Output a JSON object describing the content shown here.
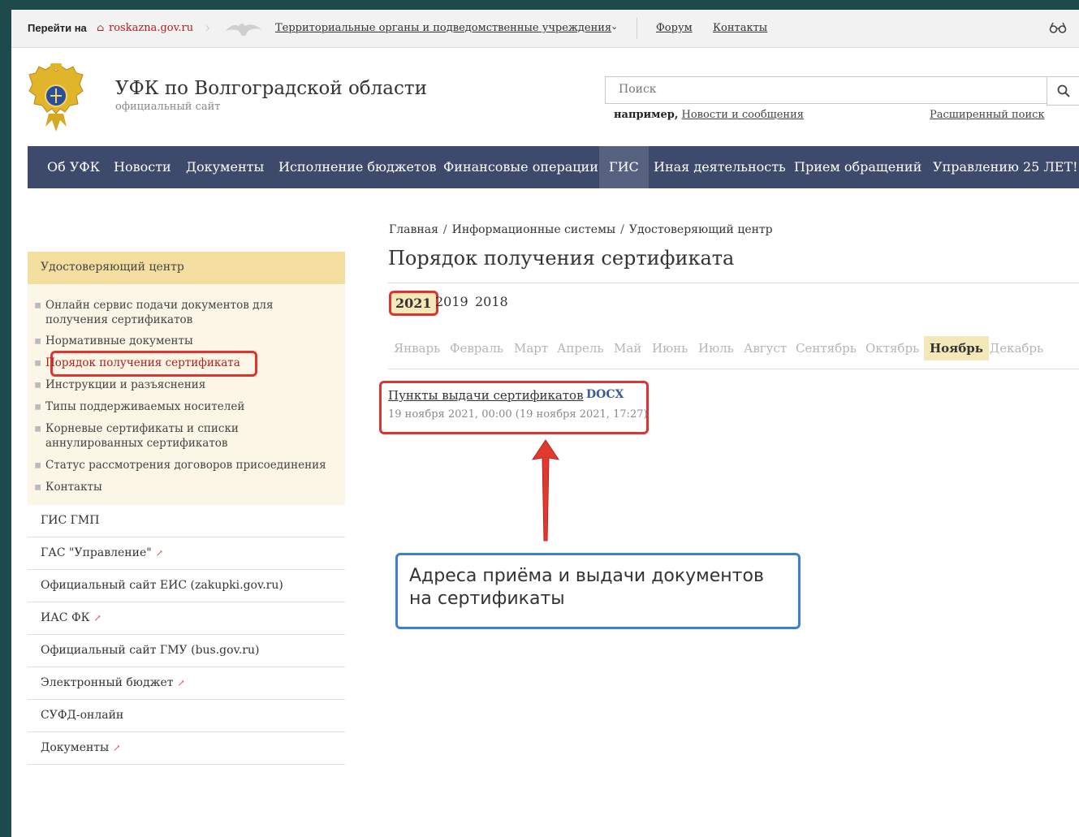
{
  "topbar": {
    "goto_label": "Перейти на",
    "roskazna_link": "roskazna.gov.ru",
    "territorial_link": "Территориальные органы и подведомственные учреждения",
    "forum_link": "Форум",
    "contacts_link": "Контакты"
  },
  "header": {
    "site_title": "УФК по Волгоградской области",
    "site_subtitle": "официальный сайт",
    "search_placeholder": "Поиск",
    "example_prefix": "например,",
    "example_link": "Новости и сообщения",
    "advanced_search": "Расширенный поиск"
  },
  "nav": {
    "items": [
      "Об УФК",
      "Новости",
      "Документы",
      "Исполнение бюджетов",
      "Финансовые операции",
      "ГИС",
      "Иная деятельность",
      "Прием обращений",
      "Управлению 25 ЛЕТ!"
    ],
    "active": "ГИС"
  },
  "breadcrumb": [
    "Главная",
    "Информационные системы",
    "Удостоверяющий центр"
  ],
  "page_title": "Порядок получения сертификата",
  "years": [
    "2021",
    "2019",
    "2018"
  ],
  "selected_year": "2021",
  "months": [
    "Январь",
    "Февраль",
    "Март",
    "Апрель",
    "Май",
    "Июнь",
    "Июль",
    "Август",
    "Сентябрь",
    "Октябрь",
    "Ноябрь",
    "Декабрь"
  ],
  "selected_month": "Ноябрь",
  "document": {
    "title": "Пункты выдачи сертификатов",
    "ext": "DOCX",
    "date": "19 ноября 2021, 00:00 (19 ноября 2021, 17:27)"
  },
  "annotation": {
    "line1": "Адреса приёма и выдачи документов",
    "line2": "на сертификаты"
  },
  "sidebar": {
    "section_title": "Удостоверяющий центр",
    "sub_items": [
      "Онлайн сервис подачи документов для получения сертификатов",
      "Нормативные документы",
      "Порядок получения сертификата",
      "Инструкции и разъяснения",
      "Типы поддерживаемых носителей",
      "Корневые сертификаты и списки аннулированных сертификатов",
      "Статус рассмотрения договоров присоединения",
      "Контакты"
    ],
    "links": [
      {
        "label": "ГИС ГМП",
        "external": ""
      },
      {
        "label": "ГАС \"Управление\"",
        "external": "↗"
      },
      {
        "label": "Официальный сайт ЕИС (zakupki.gov.ru)",
        "external": ""
      },
      {
        "label": "ИАС ФК",
        "external": "↗"
      },
      {
        "label": "Официальный сайт ГМУ (bus.gov.ru)",
        "external": ""
      },
      {
        "label": "Электронный бюджет",
        "external": "↗"
      },
      {
        "label": "СУФД-онлайн",
        "external": ""
      },
      {
        "label": "Документы",
        "external": "↗"
      }
    ]
  },
  "colors": {
    "nav_bg": "#3d4a6c",
    "nav_active": "#56627f",
    "sidebar_header": "#f3dea0",
    "highlight_red": "#dd3333",
    "annotation_blue": "#3c7fd4"
  }
}
